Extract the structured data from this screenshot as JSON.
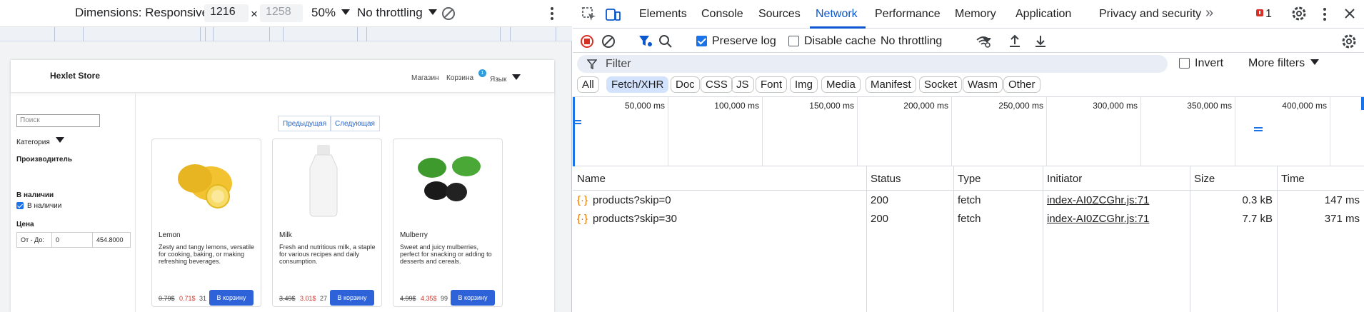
{
  "device_toolbar": {
    "dimensions_label": "Dimensions: Responsive",
    "width": "1216",
    "times": "×",
    "height_placeholder": "1258",
    "zoom": "50%",
    "throttling": "No throttling"
  },
  "store": {
    "brand": "Hexlet Store",
    "nav": {
      "shop": "Магазин",
      "cart": "Корзина",
      "cart_count": "1",
      "language": "Язык"
    },
    "sidebar": {
      "search_placeholder": "Поиск",
      "category": "Категория",
      "manufacturer": "Производитель",
      "in_stock_heading": "В наличии",
      "in_stock_option": "В наличии",
      "price_heading": "Цена",
      "price_range_label": "От - До:",
      "price_min": "0",
      "price_max": "454.8000"
    },
    "pager": {
      "prev": "Предыдущая",
      "next": "Следующая"
    },
    "products": [
      {
        "title": "Lemon",
        "description": "Zesty and tangy lemons, versatile for cooking, baking, or making refreshing beverages.",
        "old_price": "0.79$",
        "price": "0.71$",
        "qty": "31",
        "button": "В корзину"
      },
      {
        "title": "Milk",
        "description": "Fresh and nutritious milk, a staple for various recipes and daily consumption.",
        "old_price": "3.49$",
        "price": "3.01$",
        "qty": "27",
        "button": "В корзину"
      },
      {
        "title": "Mulberry",
        "description": "Sweet and juicy mulberries, perfect for snacking or adding to desserts and cereals.",
        "old_price": "4.99$",
        "price": "4.35$",
        "qty": "99",
        "button": "В корзину"
      }
    ]
  },
  "devtools": {
    "tabs": [
      "Elements",
      "Console",
      "Sources",
      "Network",
      "Performance",
      "Memory",
      "Application",
      "Privacy and security"
    ],
    "active_tab": "Network",
    "overflow": "»",
    "error_count": "1",
    "toolbar": {
      "preserve_log": "Preserve log",
      "disable_cache": "Disable cache",
      "throttling": "No throttling"
    },
    "filter": {
      "placeholder": "Filter",
      "invert": "Invert",
      "more_filters": "More filters"
    },
    "types": [
      "All",
      "Fetch/XHR",
      "Doc",
      "CSS",
      "JS",
      "Font",
      "Img",
      "Media",
      "Manifest",
      "Socket",
      "Wasm",
      "Other"
    ],
    "active_type": "Fetch/XHR",
    "timeline_ticks": [
      "50,000 ms",
      "100,000 ms",
      "150,000 ms",
      "200,000 ms",
      "250,000 ms",
      "300,000 ms",
      "350,000 ms",
      "400,000 ms"
    ],
    "columns": [
      "Name",
      "Status",
      "Type",
      "Initiator",
      "Size",
      "Time"
    ],
    "requests": [
      {
        "name": "products?skip=0",
        "status": "200",
        "type": "fetch",
        "initiator": "index-AI0ZCGhr.js:71",
        "size": "0.3 kB",
        "time": "147 ms"
      },
      {
        "name": "products?skip=30",
        "status": "200",
        "type": "fetch",
        "initiator": "index-AI0ZCGhr.js:71",
        "size": "7.7 kB",
        "time": "371 ms"
      }
    ],
    "colors": {
      "accent": "#0b57d0",
      "record": "#d93025",
      "chip_active": "#d3e3fd"
    }
  }
}
